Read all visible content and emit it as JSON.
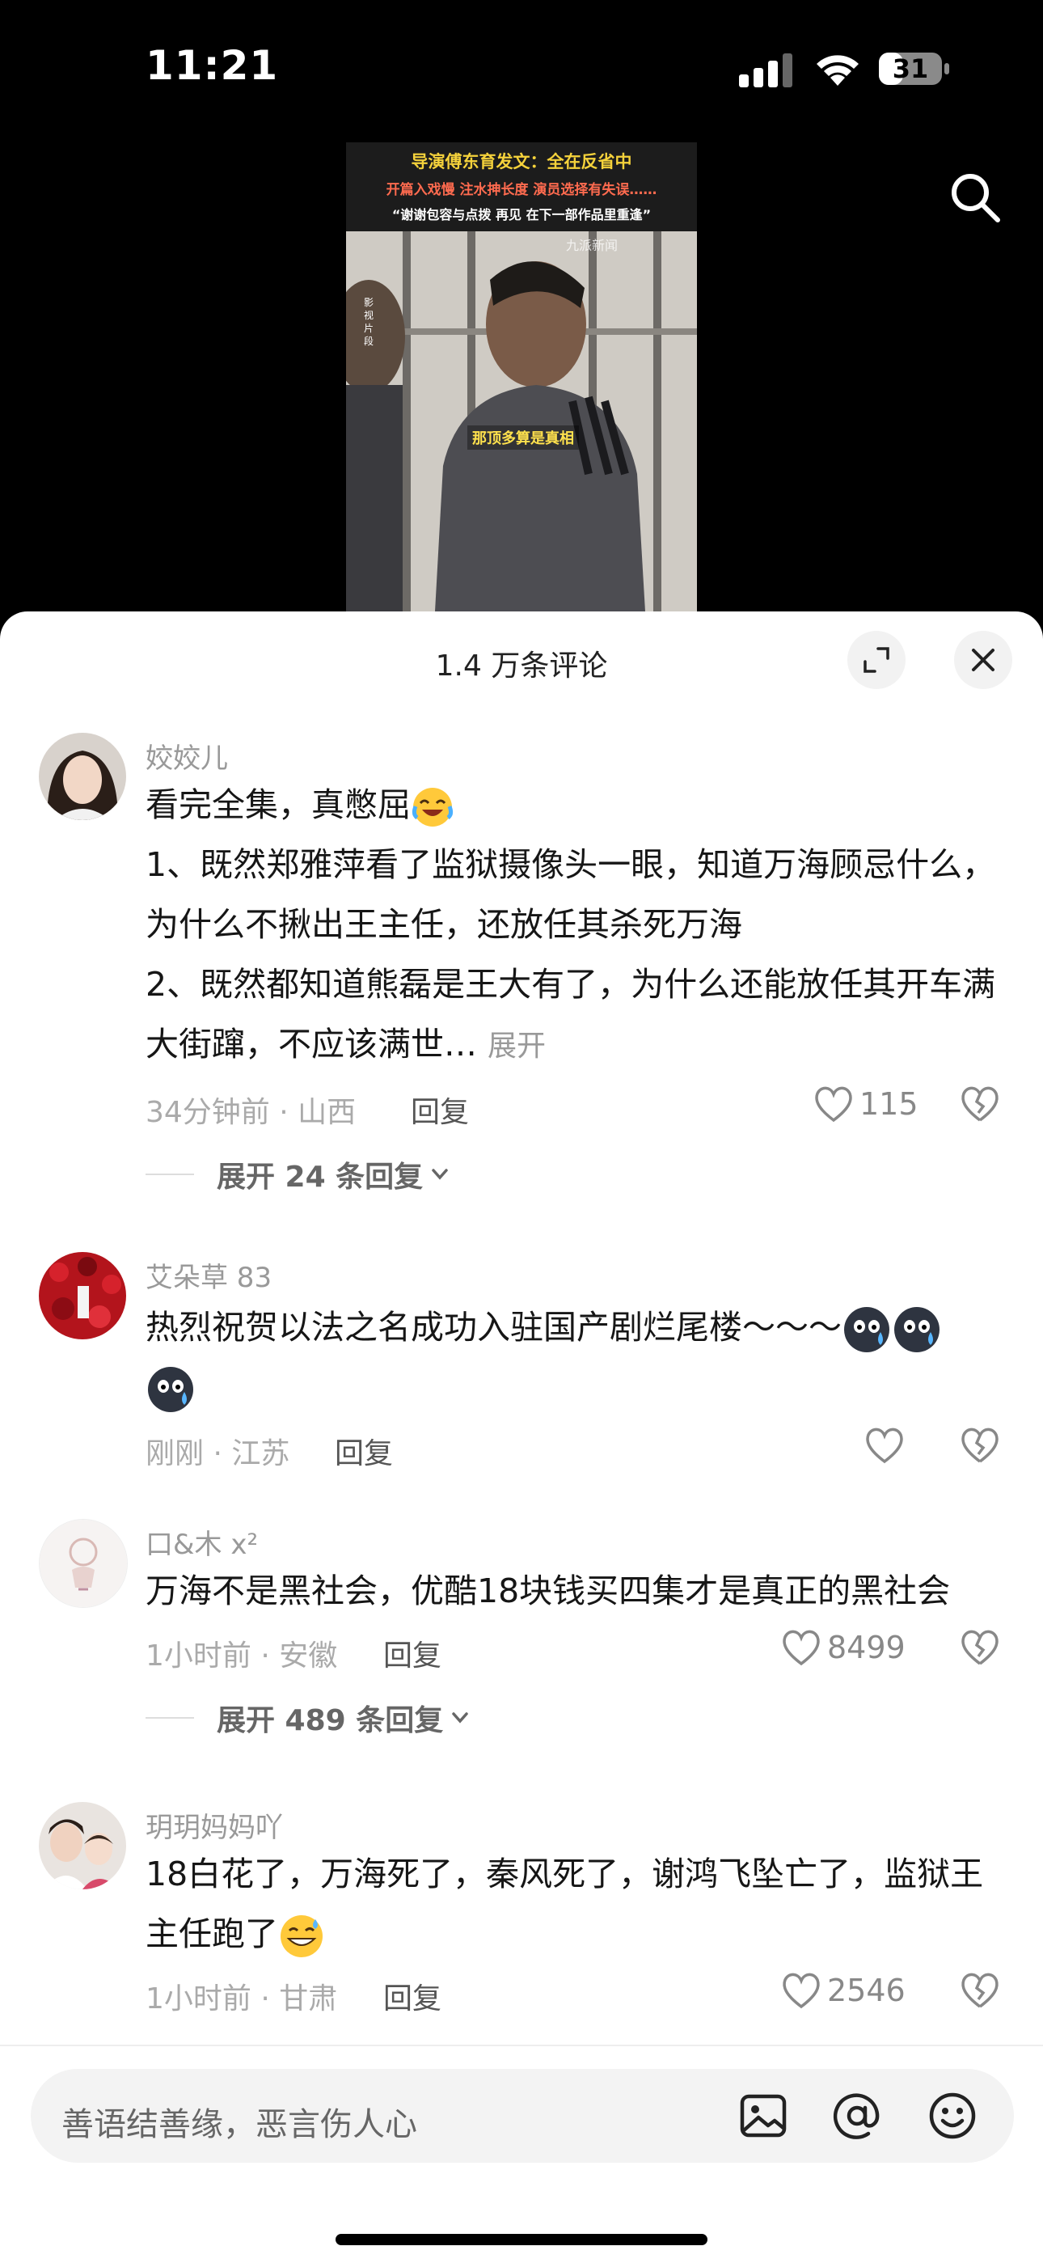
{
  "status_bar": {
    "time": "11:21",
    "battery": "31"
  },
  "video": {
    "headline1": "导演傅东育发文：全在反省中",
    "headline2": "开篇入戏慢 注水抻长度 演员选择有失误……",
    "headline3": "“谢谢包容与点拨 再见 在下一部作品里重逢”",
    "watermark": "九派新闻",
    "side_label": "影视片段",
    "subtitle": "那顶多算是真相"
  },
  "sheet": {
    "title": "1.4 万条评论"
  },
  "comments": [
    {
      "user": "姣姣儿",
      "lines": [
        "看完全集，真憋屈",
        "1、既然郑雅萍看了监狱摄像头一眼，知道万海顾忌什么，为什么不揪出王主任，还放任其杀死万海",
        "2、既然都知道熊磊是王大有了，为什么还能放任其开车满大街蹿，不应该满世…"
      ],
      "more": "展开",
      "meta": "34分钟前 · 山西",
      "reply": "回复",
      "likes": "115",
      "expand": "展开 24 条回复"
    },
    {
      "user": "艾朵草 83",
      "text": "热烈祝贺以法之名成功入驻国产剧烂尾楼～～～",
      "meta": "刚刚 · 江苏",
      "reply": "回复",
      "likes": ""
    },
    {
      "user": "口&木 x²",
      "text": "万海不是黑社会，优酷18块钱买四集才是真正的黑社会",
      "meta": "1小时前 · 安徽",
      "reply": "回复",
      "likes": "8499",
      "expand": "展开 489 条回复"
    },
    {
      "user": "玥玥妈妈吖",
      "text": "18白花了，万海死了，秦风死了，谢鸿飞坠亡了，监狱王主任跑了",
      "meta": "1小时前 · 甘肃",
      "reply": "回复",
      "likes": "2546"
    }
  ],
  "input": {
    "placeholder": "善语结善缘，恶言伤人心"
  },
  "colors": {
    "sheet_bg": "#ffffff",
    "meta_gray": "#aaaaaa",
    "title_yellow": "#f5d23b"
  }
}
